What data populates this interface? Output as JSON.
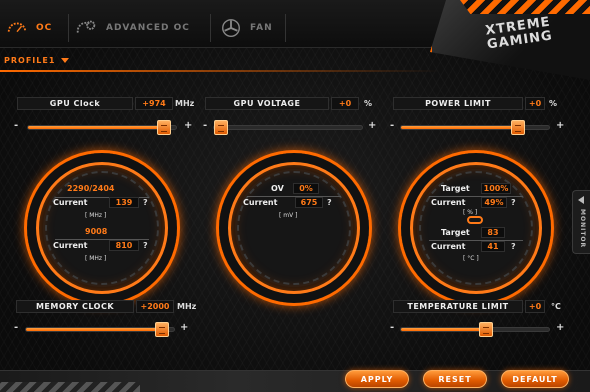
{
  "tabs": [
    {
      "label": "OC",
      "active": true,
      "icon": "gauge-icon"
    },
    {
      "label": "ADVANCED OC",
      "active": false,
      "icon": "gear-gauge-icon"
    },
    {
      "label": "FAN",
      "active": false,
      "icon": "fan-icon"
    }
  ],
  "brand": {
    "line1": "XTREME",
    "line2": "GAMING"
  },
  "profile": {
    "label": "PROFILE1"
  },
  "gpu_clock": {
    "label": "GPU Clock",
    "value": "+974",
    "unit": "MHz",
    "level": 0.96
  },
  "gpu_voltage": {
    "label": "GPU VOLTAGE",
    "value": "+0",
    "unit": "%",
    "level": 0.0
  },
  "power_limit": {
    "label": "POWER LIMIT",
    "value": "+0",
    "unit": "%",
    "level": 0.82
  },
  "memory_clock": {
    "label": "MEMORY CLOCK",
    "value": "+2000",
    "unit": "MHz",
    "level": 0.96
  },
  "temperature_limit": {
    "label": "TEMPERATURE LIMIT",
    "value": "+0",
    "unit": "°C",
    "level": 0.58
  },
  "dial_clock": {
    "core_range": "2290/2404",
    "current_label": "Current",
    "core_current": "139",
    "core_unit": "[ MHz ]",
    "mem_range": "9008",
    "mem_current": "810",
    "mem_unit": "[ MHz ]",
    "q": "?"
  },
  "dial_voltage": {
    "ov_label": "OV",
    "ov_value": "0%",
    "current_label": "Current",
    "current_value": "675",
    "unit": "[ mV ]",
    "q": "?"
  },
  "dial_power": {
    "target_label": "Target",
    "target_value": "100%",
    "current_label": "Current",
    "current_value": "49%",
    "unit1": "[ % ]",
    "target2_value": "83",
    "current2_value": "41",
    "unit2": "[ °C ]",
    "q": "?"
  },
  "monitor": {
    "label": "MONITOR"
  },
  "buttons": {
    "apply": "APPLY",
    "reset": "RESET",
    "default": "DEFAULT"
  },
  "signs": {
    "minus": "-",
    "plus": "+"
  },
  "colors": {
    "accent": "#ff6a00"
  }
}
